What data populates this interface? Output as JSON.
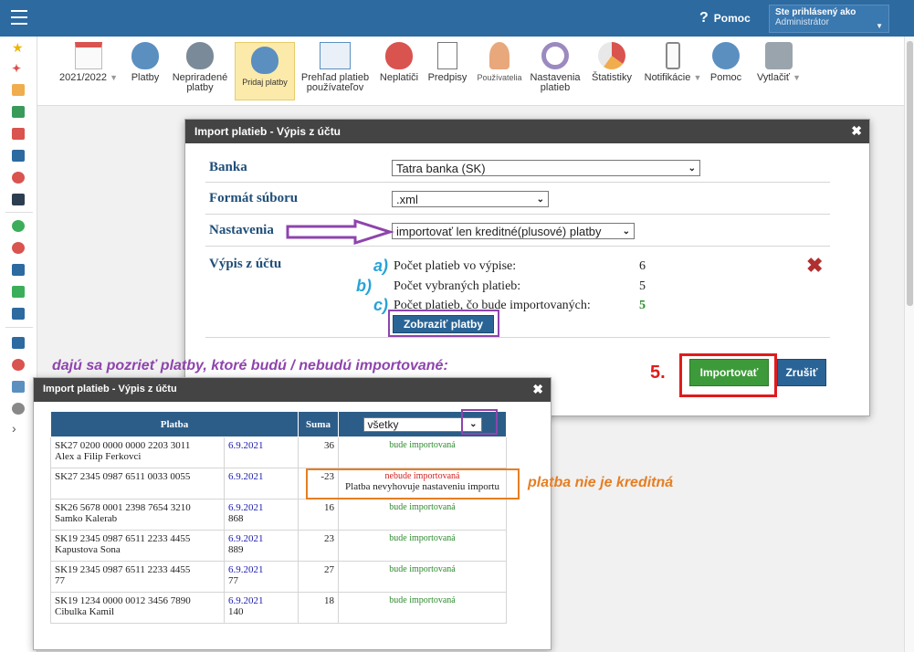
{
  "header": {
    "help_label": "Pomoc",
    "help_glyph": "?",
    "user_line1": "Ste prihlásený ako",
    "user_line2": "Administrátor"
  },
  "toolbar": {
    "items": [
      {
        "label": "2021/2022",
        "icon": "calendar-icon",
        "dropdown": true
      },
      {
        "label": "Platby",
        "icon": "money-bag-euro-icon"
      },
      {
        "label": "Nepriradené platby",
        "icon": "money-bag-question-icon"
      },
      {
        "label": "Pridaj platby",
        "icon": "money-bag-add-icon",
        "active": true
      },
      {
        "label": "Prehľad platieb používateľov",
        "icon": "ledger-euro-icon"
      },
      {
        "label": "Neplatiči",
        "icon": "money-bag-clock-icon"
      },
      {
        "label": "Predpisy",
        "icon": "document-icon"
      },
      {
        "label": "Používatelia",
        "icon": "user-icon"
      },
      {
        "label": "Nastavenia platieb",
        "icon": "gear-icon"
      },
      {
        "label": "Štatistiky",
        "icon": "pie-chart-icon"
      },
      {
        "label": "Notifikácie",
        "icon": "phone-icon",
        "dropdown": true
      },
      {
        "label": "Pomoc",
        "icon": "help-icon"
      },
      {
        "label": "Vytlačiť",
        "icon": "printer-icon",
        "dropdown": true
      }
    ]
  },
  "dialog": {
    "title": "Import platieb - Výpis z účtu",
    "bank_label": "Banka",
    "bank_value": "Tatra banka (SK)",
    "format_label": "Formát súboru",
    "format_value": ".xml",
    "settings_label": "Nastavenia",
    "settings_value": "importovať len kreditné(plusové) platby",
    "statement_label": "Výpis z účtu",
    "stats": [
      {
        "letter": "a)",
        "label": "Počet platieb vo výpise:",
        "value": "6"
      },
      {
        "letter": "b)",
        "label": "Počet vybraných platieb:",
        "value": "5"
      },
      {
        "letter": "c)",
        "label": "Počet platieb, čo bude importovaných:",
        "value": "5"
      }
    ],
    "show_button": "Zobraziť platby",
    "import_button": "Importovať",
    "cancel_button": "Zrušiť",
    "step_label": "5."
  },
  "annotations": {
    "purple": "dajú sa pozrieť platby, ktoré budú / nebudú importované:",
    "orange": "platba nie je kreditná"
  },
  "dialog2": {
    "title": "Import platieb - Výpis z účtu",
    "columns": [
      "Platba",
      "Suma"
    ],
    "filter_value": "všetky",
    "rows": [
      {
        "account": "SK27 0200 0000 0000 2203 3011",
        "name": "Alex a Filip Ferkovci",
        "date": "6.9.2021",
        "vs": "",
        "sum": "36",
        "status": "bude importovaná",
        "ok": true,
        "note": ""
      },
      {
        "account": "SK27 2345 0987 6511 0033 0055",
        "name": "",
        "date": "6.9.2021",
        "vs": "",
        "sum": "-23",
        "status": "nebude importovaná",
        "ok": false,
        "note": "Platba nevyhovuje nastaveniu importu"
      },
      {
        "account": "SK26 5678 0001 2398 7654 3210",
        "name": "Samko Kalerab",
        "date": "6.9.2021",
        "vs": "868",
        "sum": "16",
        "status": "bude importovaná",
        "ok": true,
        "note": ""
      },
      {
        "account": "SK19 2345 0987 6511 2233 4455",
        "name": "Kapustova Sona",
        "date": "6.9.2021",
        "vs": "889",
        "sum": "23",
        "status": "bude importovaná",
        "ok": true,
        "note": ""
      },
      {
        "account": "SK19 2345 0987 6511 2233 4455",
        "name": "77",
        "date": "6.9.2021",
        "vs": "77",
        "sum": "27",
        "status": "bude importovaná",
        "ok": true,
        "note": ""
      },
      {
        "account": "SK19 1234 0000 0012 3456 7890",
        "name": "Cibulka Kamil",
        "date": "6.9.2021",
        "vs": "140",
        "sum": "18",
        "status": "bude importovaná",
        "ok": true,
        "note": ""
      }
    ]
  },
  "colors": {
    "topbar": "#2c6aa0",
    "accent_purple": "#8e44ad",
    "accent_orange": "#e67e22",
    "accent_red": "#e01b1b",
    "letters": "#27a3d8"
  }
}
